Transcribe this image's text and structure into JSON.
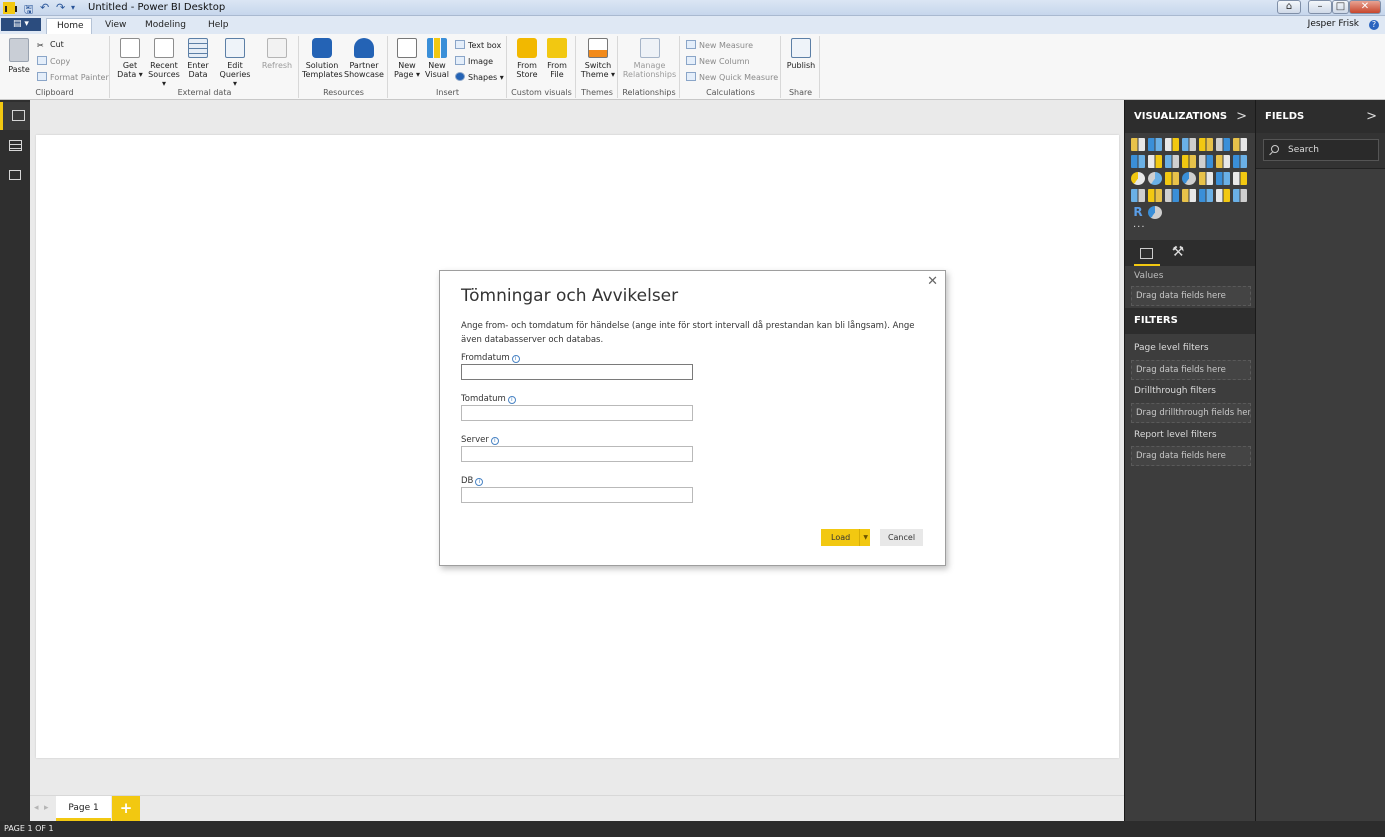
{
  "window": {
    "title": "Untitled - Power BI Desktop",
    "user": "Jesper Frisk"
  },
  "menu": {
    "file_label": "▤ ▾",
    "tabs": [
      {
        "label": "Home",
        "active": true
      },
      {
        "label": "View",
        "active": false
      },
      {
        "label": "Modeling",
        "active": false
      },
      {
        "label": "Help",
        "active": false
      }
    ]
  },
  "ribbon": {
    "clipboard": {
      "group": "Clipboard",
      "paste": "Paste",
      "cut": "Cut",
      "copy": "Copy",
      "format_painter": "Format Painter"
    },
    "external_data": {
      "group": "External data",
      "get_data": "Get Data ▾",
      "recent_sources": "Recent Sources ▾",
      "enter_data": "Enter Data",
      "edit_queries": "Edit Queries ▾",
      "refresh": "Refresh"
    },
    "resources": {
      "group": "Resources",
      "solution_templates": "Solution Templates",
      "partner_showcase": "Partner Showcase"
    },
    "insert": {
      "group": "Insert",
      "new_page": "New Page ▾",
      "new_visual": "New Visual",
      "text_box": "Text box",
      "image": "Image",
      "shapes": "Shapes ▾"
    },
    "custom_visuals": {
      "group": "Custom visuals",
      "from_store": "From Store",
      "from_file": "From File"
    },
    "themes": {
      "group": "Themes",
      "switch_theme": "Switch Theme ▾"
    },
    "relationships": {
      "group": "Relationships",
      "manage": "Manage Relationships"
    },
    "calculations": {
      "group": "Calculations",
      "new_measure": "New Measure",
      "new_column": "New Column",
      "new_quick_measure": "New Quick Measure"
    },
    "share": {
      "group": "Share",
      "publish": "Publish"
    }
  },
  "pages": {
    "tab": "Page 1",
    "add": "+",
    "status": "PAGE 1 OF 1"
  },
  "visualizations": {
    "header": "VISUALIZATIONS",
    "chevron": ">",
    "more": "···",
    "values_label": "Values",
    "values_drop": "Drag data fields here",
    "filters_header": "FILTERS",
    "page_level": "Page level filters",
    "page_drop": "Drag data fields here",
    "drillthrough": "Drillthrough filters",
    "drillthrough_drop": "Drag drillthrough fields here",
    "report_level": "Report level filters",
    "report_drop": "Drag data fields here"
  },
  "fields": {
    "header": "FIELDS",
    "chevron": ">",
    "search_placeholder": "Search"
  },
  "dialog": {
    "title": "Tömningar och Avvikelser",
    "description": "Ange from- och tomdatum för händelse (ange inte för stort intervall då prestandan kan bli långsam). Ange även databasserver och databas.",
    "fields": [
      {
        "label": "Fromdatum",
        "value": ""
      },
      {
        "label": "Tomdatum",
        "value": ""
      },
      {
        "label": "Server",
        "value": ""
      },
      {
        "label": "DB",
        "value": ""
      }
    ],
    "load": "Load",
    "cancel": "Cancel",
    "close": "✕"
  },
  "colors": {
    "accent": "#f2c811",
    "pane_dark": "#3d3d3d",
    "rail": "#2f2f2f"
  }
}
